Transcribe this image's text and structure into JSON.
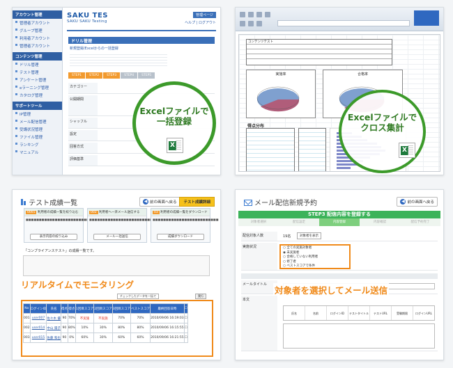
{
  "panel1": {
    "logo": "SAKU TES",
    "logo_sub": "SAKU SAKU Testing",
    "header_nav": [
      "管理ページ"
    ],
    "header_links": "ヘルプ | ログアウト",
    "sidebar": [
      {
        "group": "アカウント管理",
        "items": [
          "管理者アカウント",
          "グループ管理",
          "利用者アカウント",
          "管理者アカウント"
        ]
      },
      {
        "group": "コンテンツ管理",
        "items": [
          "ドリル管理",
          "テスト管理",
          "アンケート管理",
          "eラーニング管理",
          "カタログ管理"
        ]
      },
      {
        "group": "サポートツール",
        "items": [
          "IP管理",
          "メール配信管理",
          "受講状況管理",
          "ファイル管理",
          "ランキング",
          "マニュアル"
        ]
      }
    ],
    "page_title": "ドリル管理",
    "breadcrumb": "新規登録/Excelからの一括登録",
    "steps": [
      "STEP1",
      "STEP2",
      "STEP3",
      "STEP4",
      "STEP5"
    ],
    "form_labels": [
      "カテゴリー",
      "公開期間",
      "シャッフル",
      "設定",
      "回答方式",
      "評価基準"
    ],
    "callout": "Excelファイルで\n一括登録"
  },
  "panel2": {
    "sheet_title": "コンテンツテスト",
    "chart_titles": [
      "実施率",
      "合格率"
    ],
    "table_title": "得点分布",
    "callout": "Excelファイルで\nクロス集計"
  },
  "panel3": {
    "title": "テスト成績一覧",
    "back_button": "前の画面へ戻る",
    "export_button": "テスト成績詳細",
    "cards": [
      {
        "tag": "利用者の成績一覧を絞り込む",
        "button": "表示内容の絞り込み"
      },
      {
        "tag": "利用者へ一斉メール送信する",
        "button": "メール一括送信"
      },
      {
        "tag": "利用者の成績一覧をダウンロード",
        "button": "成績ダウンロード"
      }
    ],
    "test_name": "「コンプライアンステスト」の成績一覧です。",
    "select_label": "チェックしたデータを一括で",
    "run_label": "実行",
    "callout": "リアルタイムでモニタリング",
    "table_headers": [
      "No",
      "ログインID",
      "氏名",
      "得点",
      "得点",
      "1回目スコア",
      "2回目スコア",
      "3回目スコア",
      "ベストスコア",
      "最終回答日時",
      ""
    ],
    "rows": [
      [
        "001",
        "user007",
        "佐々木 優",
        "90",
        "70%",
        "不実施",
        "不実施",
        "70%",
        "70%",
        "2010/09/06 16:19:03"
      ],
      [
        "002",
        "user014",
        "中山 陽子",
        "90",
        "80%",
        "10%",
        "30%",
        "80%",
        "80%",
        "2010/09/06 16:15:55"
      ],
      [
        "003",
        "user015",
        "佐藤 和也",
        "90",
        "0%",
        "60%",
        "30%",
        "60%",
        "60%",
        "2010/09/06 16:21:55"
      ]
    ]
  },
  "panel4": {
    "title": "メール配信新規予約",
    "back_button": "前の画面へ戻る",
    "step_bar": "STEP3 配信内容を登録する",
    "substeps": [
      "対象者選択",
      "配信設定",
      "内容登録",
      "内容確認",
      "配信予約完了"
    ],
    "rows": [
      {
        "label": "配信対象人数",
        "value": "19名"
      },
      {
        "label": "実施状況",
        "options": [
          "全ての実施対象者",
          "未実施者",
          "合格していない利用者",
          "修了者",
          "ベストスコアで条件"
        ]
      },
      {
        "label": "メールタイトル"
      },
      {
        "label": "本文"
      }
    ],
    "callout": "対象者を選択してメール送信",
    "insert_fields": [
      "氏名",
      "名前",
      "ログインID",
      "テストタイトル",
      "テストURL",
      "受験期限",
      "ログインURL"
    ]
  }
}
